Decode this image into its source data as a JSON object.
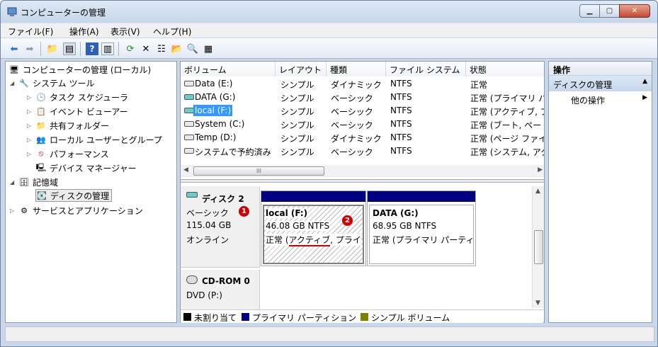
{
  "window": {
    "title": "コンピューターの管理",
    "min": "▁",
    "max": "▢",
    "close": "✕"
  },
  "menu": [
    "ファイル(F)",
    "操作(A)",
    "表示(V)",
    "ヘルプ(H)"
  ],
  "tree": {
    "root": "コンピューターの管理 (ローカル)",
    "system_tools": "システム ツール",
    "task_scheduler": "タスク スケジューラ",
    "event_viewer": "イベント ビューアー",
    "shared_folders": "共有フォルダー",
    "local_users": "ローカル ユーザーとグループ",
    "performance": "パフォーマンス",
    "device_manager": "デバイス マネージャー",
    "storage": "記憶域",
    "disk_management": "ディスクの管理",
    "services_apps": "サービスとアプリケーション"
  },
  "columns": [
    "ボリューム",
    "レイアウト",
    "種類",
    "ファイル システム",
    "状態"
  ],
  "volumes": [
    {
      "name": "Data (E:)",
      "layout": "シンプル",
      "type": "ダイナミック",
      "fs": "NTFS",
      "status": "正常"
    },
    {
      "name": "DATA (G:)",
      "layout": "シンプル",
      "type": "ベーシック",
      "fs": "NTFS",
      "status": "正常 (プライマリ パ"
    },
    {
      "name": "local (F:)",
      "layout": "シンプル",
      "type": "ベーシック",
      "fs": "NTFS",
      "status": "正常 (アクティブ, プ"
    },
    {
      "name": "System (C:)",
      "layout": "シンプル",
      "type": "ベーシック",
      "fs": "NTFS",
      "status": "正常 (ブート, ペー"
    },
    {
      "name": "Temp (D:)",
      "layout": "シンプル",
      "type": "ダイナミック",
      "fs": "NTFS",
      "status": "正常 (ページ ファイ"
    },
    {
      "name": "システムで予約済み",
      "layout": "シンプル",
      "type": "ベーシック",
      "fs": "NTFS",
      "status": "正常 (システム, アク"
    }
  ],
  "hscroll_grip": "III",
  "disk2": {
    "title": "ディスク 2",
    "kind": "ベーシック",
    "size": "115.04 GB",
    "state": "オンライン"
  },
  "part_local": {
    "name": "local  (F:)",
    "size": "46.08 GB NTFS",
    "status_pre": "正常 (",
    "status_u": "アクティブ",
    "status_post": ", プライ"
  },
  "part_data": {
    "name": "DATA  (G:)",
    "size": "68.95 GB NTFS",
    "status": "正常 (プライマリ パーティ"
  },
  "cdrom": {
    "title": "CD-ROM 0",
    "drive": "DVD (P:)"
  },
  "legend": [
    "未割り当て",
    "プライマリ パーティション",
    "シンプル ボリューム"
  ],
  "badges": [
    "1",
    "2"
  ],
  "actions": {
    "header": "操作",
    "section": "ディスクの管理",
    "more": "他の操作"
  },
  "colors": {
    "primary_partition": "#000080",
    "simple_volume": "#808000",
    "selection": "#3399ff",
    "badge": "#d20000"
  }
}
